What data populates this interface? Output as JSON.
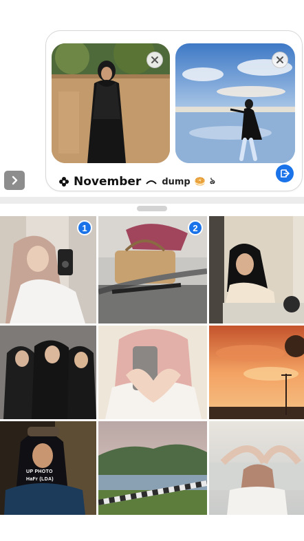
{
  "compose": {
    "caption_main": "November",
    "caption_sub": "dump",
    "caption_emoji": "🥯",
    "caption_deco": "ঌ"
  },
  "icons": {
    "expand": "chevron-right-icon",
    "remove": "close-icon",
    "send": "send-icon",
    "flower": "flower-icon"
  },
  "gallery": {
    "selected_badges": [
      "1",
      "2"
    ],
    "watermark_title": "UP PHOTO",
    "watermark_handle": "HaFr (LDA)"
  },
  "colors": {
    "accent": "#1a73e8",
    "expand_button": "#8d8d8d"
  }
}
